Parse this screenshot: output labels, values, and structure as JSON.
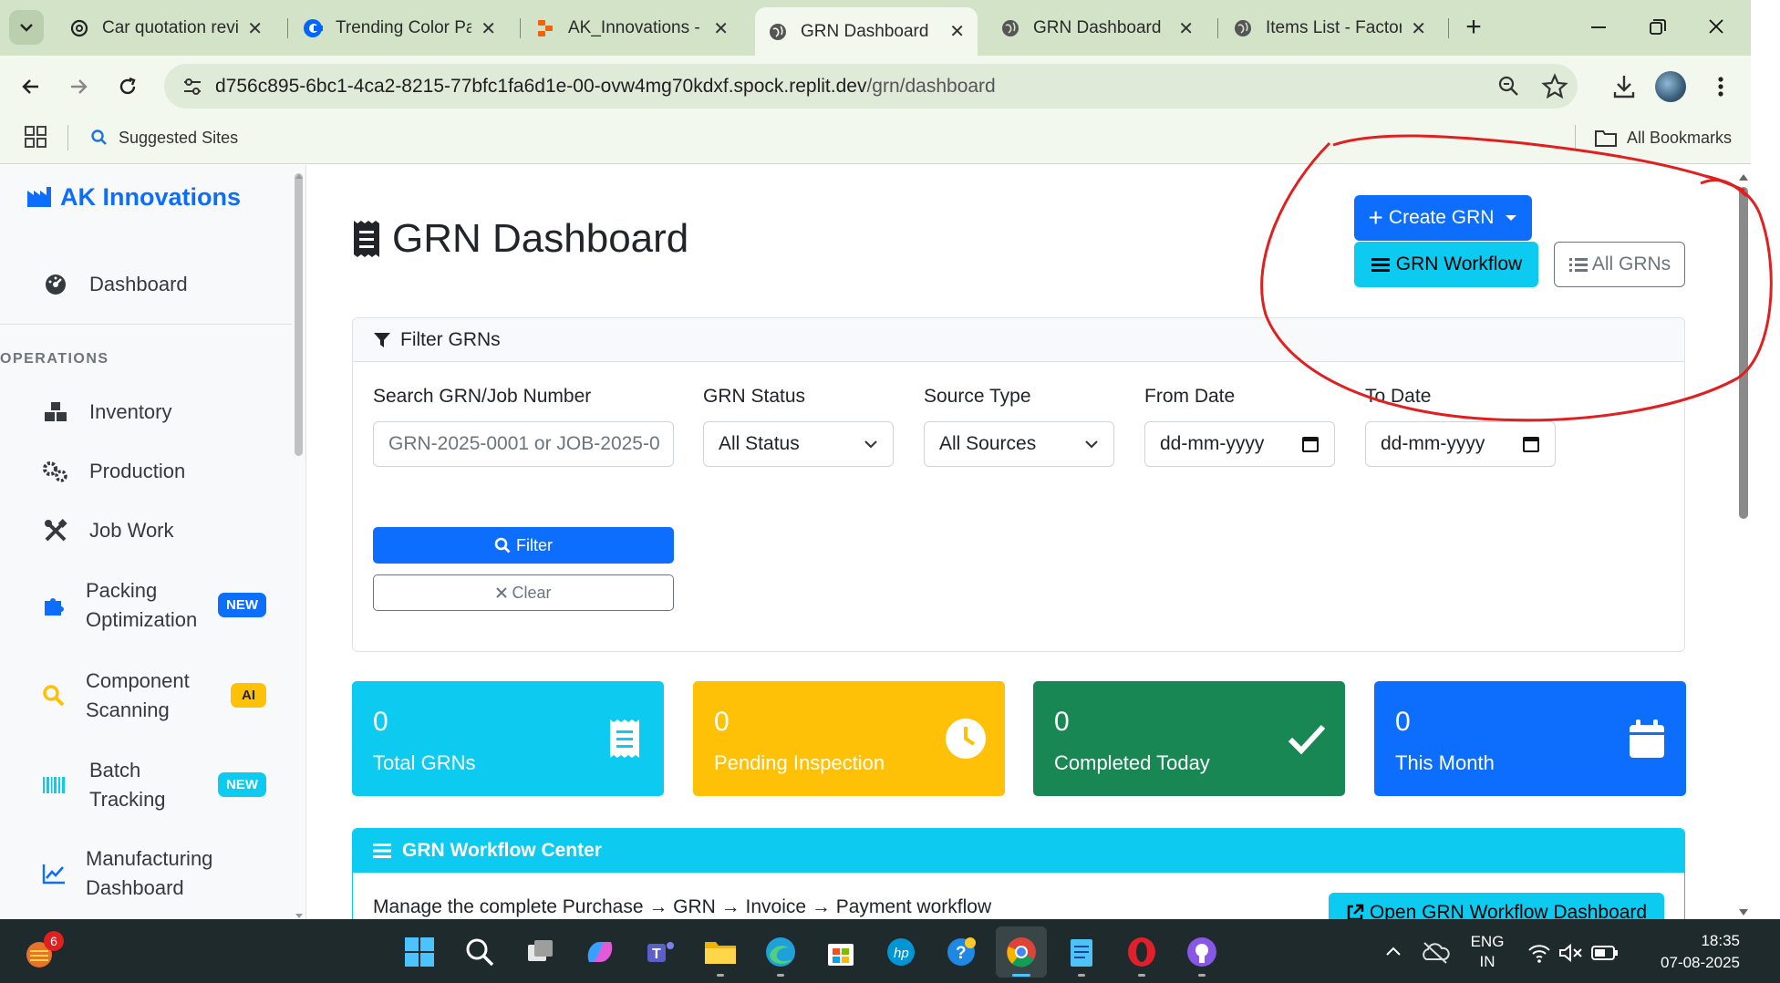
{
  "browser": {
    "tabs": [
      {
        "title": "Car quotation revie",
        "icon": "openai-icon",
        "active": false
      },
      {
        "title": "Trending Color Pal",
        "icon": "coolors-icon",
        "active": false
      },
      {
        "title": "AK_Innovations - R",
        "icon": "replit-icon",
        "active": false
      },
      {
        "title": "GRN Dashboard",
        "icon": "globe-icon",
        "active": true
      },
      {
        "title": "GRN Dashboard",
        "icon": "globe-icon",
        "active": false
      },
      {
        "title": "Items List - Factory",
        "icon": "globe-icon",
        "active": false
      }
    ],
    "new_tab_label": "+",
    "url_host": "d756c895-6bc1-4ca2-8215-77bfc1fa6d1e-00-ovw4mg70kdxf.spock.replit.dev",
    "url_path": "/grn/dashboard",
    "bookmarks": {
      "suggested": "Suggested Sites",
      "all": "All Bookmarks"
    }
  },
  "sidebar": {
    "brand": "AK Innovations",
    "dashboard": "Dashboard",
    "section": "OPERATIONS",
    "items": [
      {
        "label": "Inventory",
        "icon": "boxes-icon"
      },
      {
        "label": "Production",
        "icon": "cogs-icon"
      },
      {
        "label": "Job Work",
        "icon": "tools-icon"
      },
      {
        "label1": "Packing",
        "label2": "Optimization",
        "icon": "puzzle-icon",
        "badge": "NEW",
        "badge_color": "#0d6efd"
      },
      {
        "label1": "Component",
        "label2": "Scanning",
        "icon": "search-icon",
        "badge": "AI",
        "badge_color": "#ffc107"
      },
      {
        "label1": "Batch",
        "label2": "Tracking",
        "icon": "barcode-icon",
        "badge": "NEW",
        "badge_color": "#0dcaf0"
      },
      {
        "label1": "Manufacturing",
        "label2": "Dashboard",
        "icon": "chart-line-icon"
      }
    ]
  },
  "page": {
    "title": "GRN Dashboard",
    "create_btn": "Create GRN",
    "workflow_btn": "GRN Workflow",
    "all_btn": "All GRNs"
  },
  "filter": {
    "header": "Filter GRNs",
    "search_label": "Search GRN/Job Number",
    "search_placeholder": "GRN-2025-0001 or JOB-2025-0",
    "status_label": "GRN Status",
    "status_value": "All Status",
    "source_label": "Source Type",
    "source_value": "All Sources",
    "from_label": "From Date",
    "from_value": "dd-mm-yyyy",
    "to_label": "To Date",
    "to_value": "dd-mm-yyyy",
    "filter_btn": "Filter",
    "clear_btn": "Clear"
  },
  "stats": [
    {
      "value": "0",
      "label": "Total GRNs",
      "color": "#0dcaf0",
      "icon": "receipt-icon"
    },
    {
      "value": "0",
      "label": "Pending Inspection",
      "color": "#ffc107",
      "icon": "clock-icon"
    },
    {
      "value": "0",
      "label": "Completed Today",
      "color": "#198754",
      "icon": "check-icon"
    },
    {
      "value": "0",
      "label": "This Month",
      "color": "#0d6efd",
      "icon": "calendar-icon"
    }
  ],
  "workflow": {
    "header": "GRN Workflow Center",
    "description": "Manage the complete Purchase → GRN → Invoice → Payment workflow",
    "open_btn": "Open GRN Workflow Dashboard"
  },
  "taskbar": {
    "notification_count": "6",
    "lang1": "ENG",
    "lang2": "IN",
    "time": "18:35",
    "date": "07-08-2025"
  },
  "colors": {
    "primary": "#0d6efd",
    "info": "#0dcaf0",
    "annotation": "#e02020"
  }
}
